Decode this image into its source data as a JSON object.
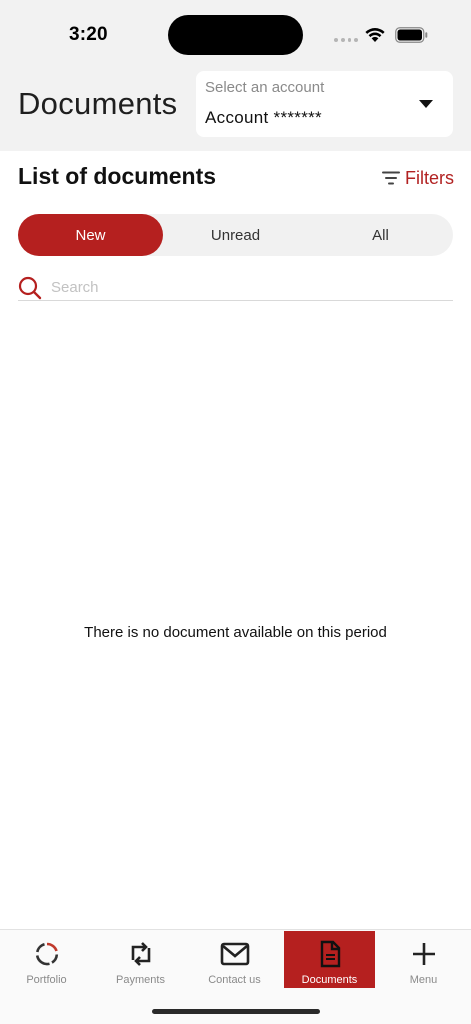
{
  "status_bar": {
    "time": "3:20"
  },
  "header": {
    "title": "Documents",
    "account": {
      "label": "Select an account",
      "value": "Account *******"
    }
  },
  "list": {
    "title": "List of documents",
    "filters_label": "Filters",
    "tabs": [
      {
        "label": "New",
        "active": true
      },
      {
        "label": "Unread",
        "active": false
      },
      {
        "label": "All",
        "active": false
      }
    ],
    "search": {
      "placeholder": "Search",
      "value": ""
    },
    "empty_message": "There is no document available on this period"
  },
  "tabbar": {
    "items": [
      {
        "label": "Portfolio",
        "icon": "donut-chart-icon",
        "active": false
      },
      {
        "label": "Payments",
        "icon": "transfer-icon",
        "active": false
      },
      {
        "label": "Contact us",
        "icon": "envelope-icon",
        "active": false
      },
      {
        "label": "Documents",
        "icon": "document-icon",
        "active": true
      },
      {
        "label": "Menu",
        "icon": "plus-icon",
        "active": false
      }
    ]
  },
  "colors": {
    "accent": "#b5201f",
    "filters": "#b22222",
    "header_bg": "#f2f2f2"
  }
}
